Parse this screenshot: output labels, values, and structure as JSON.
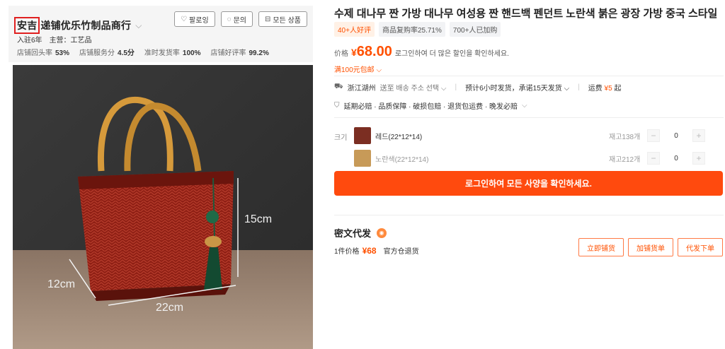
{
  "store": {
    "name_highlight": "安吉",
    "name_rest": "递铺优乐竹制品商行",
    "follow_label": "팔로잉",
    "inquiry_label": "문의",
    "all_products_label": "모든 상품",
    "years": "入驻6年",
    "main_business": "主营：工艺品",
    "stats": [
      {
        "label": "店铺回头率",
        "value": "53%"
      },
      {
        "label": "店铺服务分",
        "value": "4.5分"
      },
      {
        "label": "准时发货率",
        "value": "100%"
      },
      {
        "label": "店铺好评率",
        "value": "99.2%"
      }
    ]
  },
  "photo": {
    "dim_height": "15cm",
    "dim_depth": "12cm",
    "dim_width": "22cm"
  },
  "product": {
    "title": "수제 대나무 짠 가방 대나무 여성용 짠 핸드백 펜던트 노란색 붉은 광장 가방 중국 스타일",
    "tags": [
      "40+人好评",
      "商品复购率25.71%",
      "700+人已加购"
    ],
    "price_label": "价格",
    "currency": "¥",
    "price": "68.00",
    "price_login": "로그인하여 더 많은 할인을 확인하세요.",
    "promo": "满100元包邮",
    "ship_from": "浙江湖州",
    "ship_to": "送至 배송 주소 선택",
    "ship_promise": "预计6小时发货，承诺15天发货",
    "ship_fee_label": "运费",
    "ship_fee": "¥5",
    "ship_fee_suffix": "起",
    "guarantees": "延期必赔 · 品质保障 · 破损包赔 · 退货包运费 · 晚发必赔"
  },
  "sku": {
    "label": "크기",
    "items": [
      {
        "name": "레드(22*12*14)",
        "stock": "재고138개",
        "qty": "0"
      },
      {
        "name": "노란색(22*12*14)",
        "stock": "재고212개",
        "qty": "0"
      }
    ]
  },
  "cta": {
    "label": "로그인하여 모든 사양을 확인하세요."
  },
  "dropship": {
    "title": "密文代发",
    "price_label": "1件价格",
    "currency": "¥",
    "price": "68",
    "return_note": "官方仓退货",
    "buttons": [
      "立即铺货",
      "加铺货单",
      "代发下单"
    ]
  },
  "colors": {
    "accent": "#ff5000",
    "cta": "#ff4a0e",
    "highlight_box": "#e02020"
  }
}
